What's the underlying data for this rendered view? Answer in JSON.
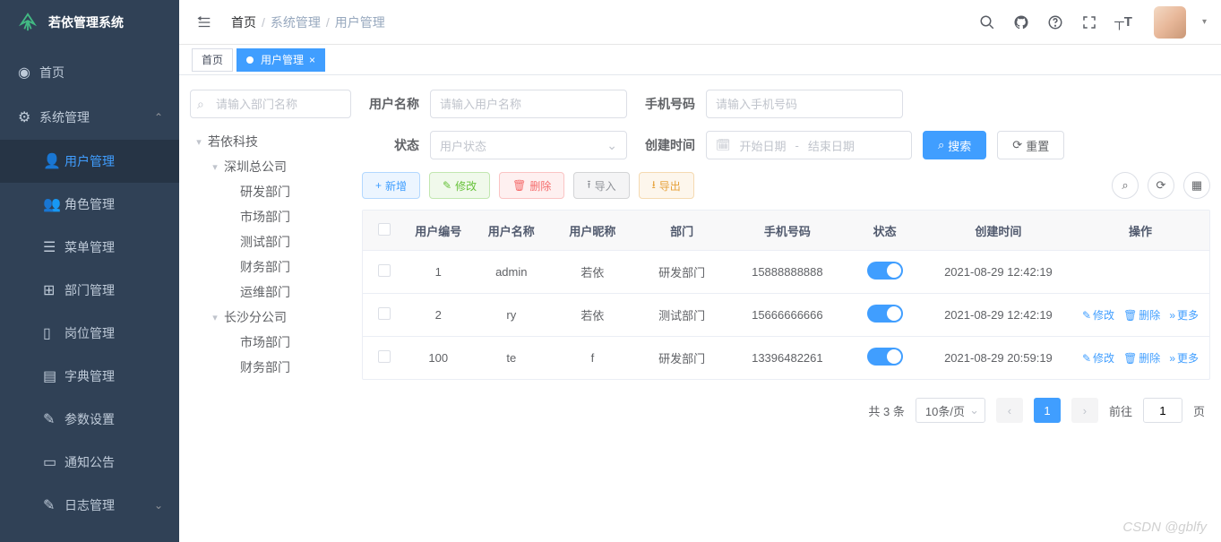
{
  "app": {
    "title": "若依管理系统"
  },
  "sidebar": {
    "items": [
      {
        "label": "首页"
      },
      {
        "label": "系统管理"
      },
      {
        "label": "用户管理"
      },
      {
        "label": "角色管理"
      },
      {
        "label": "菜单管理"
      },
      {
        "label": "部门管理"
      },
      {
        "label": "岗位管理"
      },
      {
        "label": "字典管理"
      },
      {
        "label": "参数设置"
      },
      {
        "label": "通知公告"
      },
      {
        "label": "日志管理"
      }
    ]
  },
  "breadcrumb": {
    "items": [
      "首页",
      "系统管理",
      "用户管理"
    ]
  },
  "tabs": {
    "home": "首页",
    "active": "用户管理"
  },
  "tree": {
    "placeholder": "请输入部门名称",
    "root": "若依科技",
    "branch1": "深圳总公司",
    "b1_children": [
      "研发部门",
      "市场部门",
      "测试部门",
      "财务部门",
      "运维部门"
    ],
    "branch2": "长沙分公司",
    "b2_children": [
      "市场部门",
      "财务部门"
    ]
  },
  "filters": {
    "username_label": "用户名称",
    "username_ph": "请输入用户名称",
    "phone_label": "手机号码",
    "phone_ph": "请输入手机号码",
    "status_label": "状态",
    "status_ph": "用户状态",
    "create_label": "创建时间",
    "date_start": "开始日期",
    "date_sep": "-",
    "date_end": "结束日期",
    "search": "搜索",
    "reset": "重置"
  },
  "toolbar": {
    "add": "新增",
    "edit": "修改",
    "delete": "删除",
    "import": "导入",
    "export": "导出"
  },
  "table": {
    "headers": {
      "id": "用户编号",
      "name": "用户名称",
      "nick": "用户昵称",
      "dept": "部门",
      "phone": "手机号码",
      "status": "状态",
      "time": "创建时间",
      "ops": "操作"
    },
    "rows": [
      {
        "id": "1",
        "name": "admin",
        "nick": "若依",
        "dept": "研发部门",
        "phone": "15888888888",
        "time": "2021-08-29 12:42:19",
        "showOps": false
      },
      {
        "id": "2",
        "name": "ry",
        "nick": "若依",
        "dept": "测试部门",
        "phone": "15666666666",
        "time": "2021-08-29 12:42:19",
        "showOps": true
      },
      {
        "id": "100",
        "name": "te",
        "nick": "f",
        "dept": "研发部门",
        "phone": "13396482261",
        "time": "2021-08-29 20:59:19",
        "showOps": true
      }
    ],
    "ops": {
      "edit": "修改",
      "delete": "删除",
      "more": "更多"
    }
  },
  "pager": {
    "total": "共 3 条",
    "pagesize": "10条/页",
    "page": "1",
    "goto_prefix": "前往",
    "goto_value": "1",
    "goto_suffix": "页"
  },
  "watermark": "CSDN @gblfy"
}
